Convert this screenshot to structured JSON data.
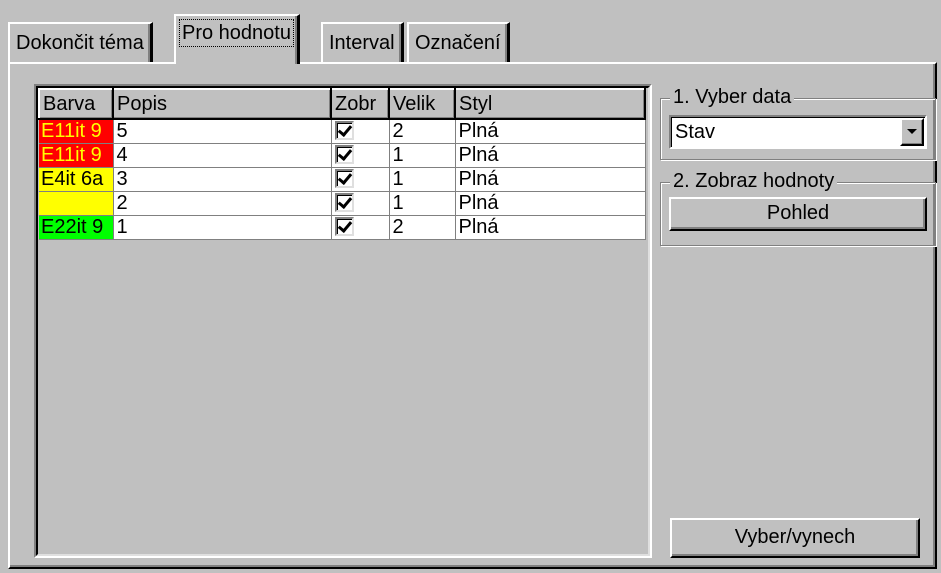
{
  "tabs": [
    {
      "label": "Dokončit téma",
      "active": false
    },
    {
      "label": "Pro hodnotu",
      "active": true
    },
    {
      "label": "Interval",
      "active": false
    },
    {
      "label": "Označení",
      "active": false
    }
  ],
  "grid": {
    "columns": [
      "Barva",
      "Popis",
      "Zobr",
      "Velik",
      "Styl"
    ],
    "rows": [
      {
        "barva": "E11it 9",
        "color": "#ff0000",
        "text_color": "#ffff00",
        "popis": "5",
        "zobr": true,
        "velik": "2",
        "styl": "Plná"
      },
      {
        "barva": "E11it 9",
        "color": "#ff0000",
        "text_color": "#ffff00",
        "popis": "4",
        "zobr": true,
        "velik": "1",
        "styl": "Plná"
      },
      {
        "barva": "E4it 6a",
        "color": "#ffff00",
        "text_color": "#000000",
        "popis": "3",
        "zobr": true,
        "velik": "1",
        "styl": "Plná"
      },
      {
        "barva": "",
        "color": "#ffff00",
        "text_color": "#000000",
        "popis": "2",
        "zobr": true,
        "velik": "1",
        "styl": "Plná"
      },
      {
        "barva": "E22it 9",
        "color": "#00ff00",
        "text_color": "#000000",
        "popis": "1",
        "zobr": true,
        "velik": "2",
        "styl": "Plná"
      }
    ]
  },
  "select_data": {
    "title": "1. Vyber data",
    "value": "Stav"
  },
  "show_values": {
    "title": "2. Zobraz hodnoty",
    "button_label": "Pohled"
  },
  "toggle_button_label": "Vyber/vynech",
  "colors": {
    "face": "#c0c0c0",
    "red": "#ff0000",
    "yellow": "#ffff00",
    "green": "#00ff00"
  }
}
